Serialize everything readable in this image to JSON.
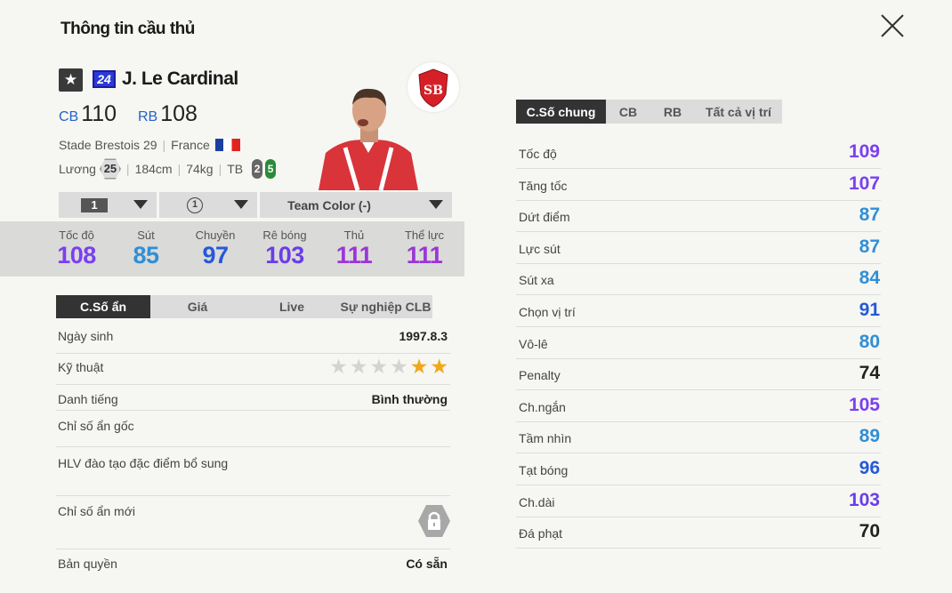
{
  "title": "Thông tin cầu thủ",
  "player": {
    "season": "24",
    "name": "J. Le Cardinal",
    "positions": [
      {
        "pos": "CB",
        "ovr": "110"
      },
      {
        "pos": "RB",
        "ovr": "108"
      }
    ],
    "club_number": "Stade Brestois 29",
    "nation": "France",
    "salary_label": "Lương",
    "salary": "25",
    "height": "184cm",
    "weight": "74kg",
    "body": "TB",
    "weak_foot": "2",
    "strong_foot": "5"
  },
  "selectors": {
    "level": "1",
    "rank": "1",
    "team_color": "Team Color (-)"
  },
  "main_stats": [
    {
      "label": "Tốc độ",
      "value": "108",
      "color": "#7a3ff0"
    },
    {
      "label": "Sút",
      "value": "85",
      "color": "#2f8fd6"
    },
    {
      "label": "Chuyền",
      "value": "97",
      "color": "#2559d9"
    },
    {
      "label": "Rê bóng",
      "value": "103",
      "color": "#6a3de8"
    },
    {
      "label": "Thủ",
      "value": "111",
      "color": "#9b35d8"
    },
    {
      "label": "Thể lực",
      "value": "111",
      "color": "#9b35d8"
    }
  ],
  "left_tabs": [
    "C.Số ẩn",
    "Giá",
    "Live",
    "Sự nghiệp CLB"
  ],
  "info": {
    "birth_label": "Ngày sinh",
    "birth": "1997.8.3",
    "skill_label": "Kỹ thuật",
    "skill_stars": 2,
    "skill_total": 6,
    "fame_label": "Danh tiếng",
    "fame": "Bình thường",
    "traits_label": "Chỉ số ẩn gốc",
    "coach_label": "HLV đào tạo đặc điểm bổ sung",
    "new_traits_label": "Chỉ số ẩn mới",
    "license_label": "Bản quyền",
    "license": "Có sẵn"
  },
  "right_tabs": [
    "C.Số chung",
    "CB",
    "RB",
    "Tất cả vị trí"
  ],
  "detail_stats": [
    {
      "label": "Tốc độ",
      "value": "109",
      "color": "#7a3ff0"
    },
    {
      "label": "Tăng tốc",
      "value": "107",
      "color": "#7a3ff0"
    },
    {
      "label": "Dứt điểm",
      "value": "87",
      "color": "#2f8fd6"
    },
    {
      "label": "Lực sút",
      "value": "87",
      "color": "#2f8fd6"
    },
    {
      "label": "Sút xa",
      "value": "84",
      "color": "#2f8fd6"
    },
    {
      "label": "Chọn vị trí",
      "value": "91",
      "color": "#2559d9"
    },
    {
      "label": "Vô-lê",
      "value": "80",
      "color": "#2f8fd6"
    },
    {
      "label": "Penalty",
      "value": "74",
      "color": "#222222"
    },
    {
      "label": "Ch.ngắn",
      "value": "105",
      "color": "#7a3ff0"
    },
    {
      "label": "Tầm nhìn",
      "value": "89",
      "color": "#2f8fd6"
    },
    {
      "label": "Tạt bóng",
      "value": "96",
      "color": "#2559d9"
    },
    {
      "label": "Ch.dài",
      "value": "103",
      "color": "#6a3de8"
    },
    {
      "label": "Đá phạt",
      "value": "70",
      "color": "#222222"
    }
  ]
}
